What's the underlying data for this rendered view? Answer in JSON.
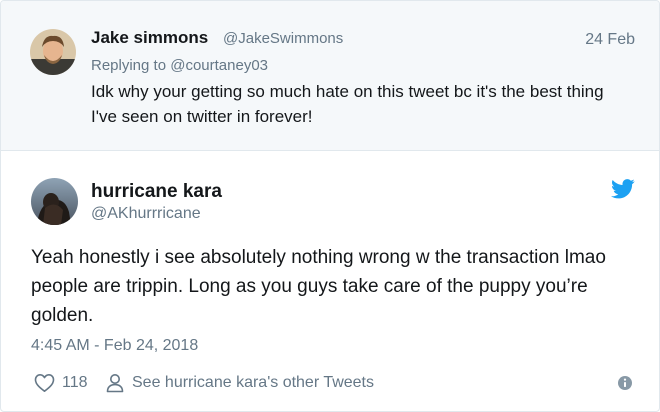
{
  "parent_tweet": {
    "author_name": "Jake simmons",
    "author_handle": "@JakeSwimmons",
    "date": "24 Feb",
    "replying_to_prefix": "Replying to ",
    "replying_to_handle": "@courtaney03",
    "text": "Idk why your getting so much hate on this tweet bc it's the best thing I've seen on twitter in forever!"
  },
  "main_tweet": {
    "author_name": "hurricane kara",
    "author_handle": "@AKhurrricane",
    "text": "Yeah honestly i see absolutely nothing wrong w the transaction lmao people are trippin. Long as you guys take care of the puppy you’re golden.",
    "timestamp": "4:45 AM - Feb 24, 2018"
  },
  "actions": {
    "like_count": "118",
    "other_tweets_label": "See hurricane kara's other Tweets"
  },
  "icons": {
    "twitter_bird": "twitter-bird-icon",
    "heart": "heart-icon",
    "person": "person-icon",
    "info": "info-icon"
  },
  "colors": {
    "twitter_blue": "#1da1f2",
    "secondary_text": "#657786",
    "primary_text": "#14171a",
    "reply_background": "#f5f8fa"
  }
}
